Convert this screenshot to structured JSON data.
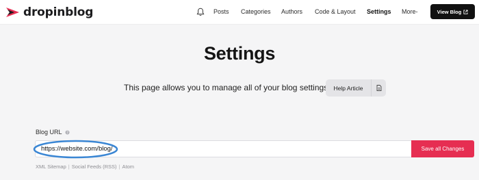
{
  "brand": {
    "name": "dropinblog",
    "accent": "#e62e52"
  },
  "nav": {
    "items": [
      {
        "label": "Posts"
      },
      {
        "label": "Categories"
      },
      {
        "label": "Authors"
      },
      {
        "label": "Code & Layout"
      },
      {
        "label": "Settings",
        "active": true
      },
      {
        "label": "More-"
      }
    ],
    "view_blog_label": "View Blog",
    "notification_icon": "bell-icon"
  },
  "page": {
    "title": "Settings",
    "intro": "This page allows you to manage all of your blog settings.",
    "help_label": "Help Article"
  },
  "blog_url": {
    "label": "Blog URL",
    "value": "https://website.com/blog/",
    "save_label": "Save all Changes",
    "links": [
      "XML Sitemap",
      "Social Feeds (RSS)",
      "Atom"
    ],
    "highlight_color": "#3a86d4"
  }
}
